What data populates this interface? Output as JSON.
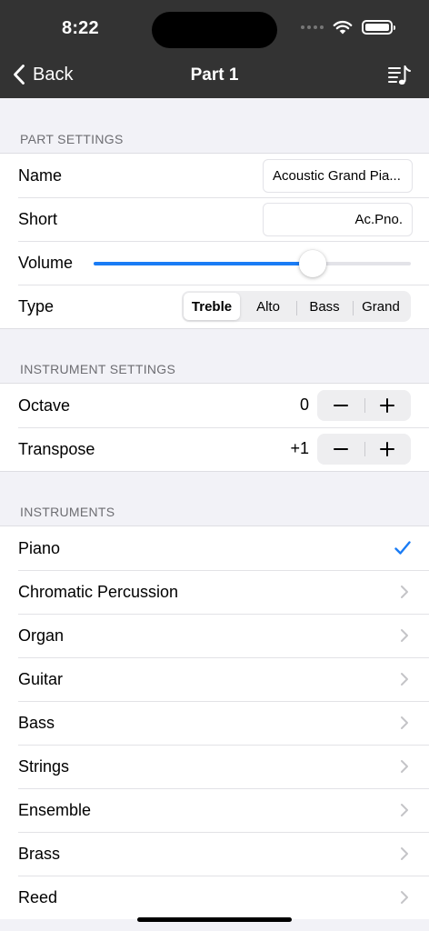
{
  "status_bar": {
    "time": "8:22"
  },
  "nav": {
    "back_label": "Back",
    "title": "Part 1"
  },
  "part_settings": {
    "header": "PART SETTINGS",
    "name": {
      "label": "Name",
      "value": "Acoustic Grand Pia..."
    },
    "short": {
      "label": "Short",
      "value": "Ac.Pno."
    },
    "volume": {
      "label": "Volume",
      "level": 0.69
    },
    "type": {
      "label": "Type",
      "options": [
        "Treble",
        "Alto",
        "Bass",
        "Grand"
      ],
      "selected": "Treble"
    }
  },
  "instrument_settings": {
    "header": "INSTRUMENT SETTINGS",
    "octave": {
      "label": "Octave",
      "value": "0"
    },
    "transpose": {
      "label": "Transpose",
      "value": "+1"
    }
  },
  "instruments": {
    "header": "INSTRUMENTS",
    "items": [
      {
        "label": "Piano",
        "accessory": "checkmark-icon"
      },
      {
        "label": "Chromatic Percussion",
        "accessory": "chevron-right-icon"
      },
      {
        "label": "Organ",
        "accessory": "chevron-right-icon"
      },
      {
        "label": "Guitar",
        "accessory": "chevron-right-icon"
      },
      {
        "label": "Bass",
        "accessory": "chevron-right-icon"
      },
      {
        "label": "Strings",
        "accessory": "chevron-right-icon"
      },
      {
        "label": "Ensemble",
        "accessory": "chevron-right-icon"
      },
      {
        "label": "Brass",
        "accessory": "chevron-right-icon"
      },
      {
        "label": "Reed",
        "accessory": "chevron-right-icon"
      }
    ]
  },
  "colors": {
    "accent": "#1a7cf5",
    "nav_bar": "#333333",
    "background": "#f2f2f7",
    "secondary_text": "#6d6d72",
    "chevron": "#c4c4c7"
  }
}
